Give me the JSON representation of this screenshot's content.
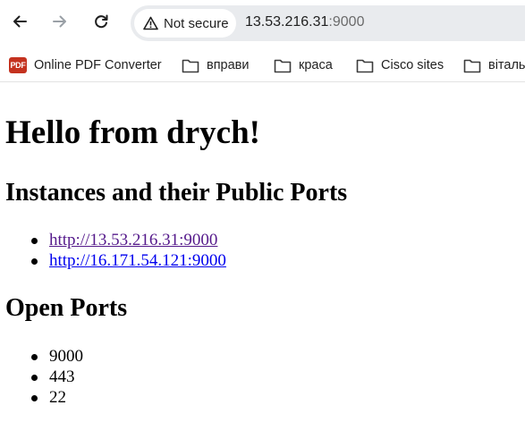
{
  "browser": {
    "security_label": "Not secure",
    "url_host": "13.53.216.31",
    "url_port": ":9000"
  },
  "bookmarks": [
    {
      "label": "Online PDF Converter",
      "icon": "pdf-icon",
      "badge": "PDF"
    },
    {
      "label": "вправи",
      "icon": "folder-icon"
    },
    {
      "label": "краса",
      "icon": "folder-icon"
    },
    {
      "label": "Cisco sites",
      "icon": "folder-icon"
    },
    {
      "label": "віталь",
      "icon": "folder-icon"
    }
  ],
  "page": {
    "heading": "Hello from drych!",
    "instances_heading": "Instances and their Public Ports",
    "instances": [
      {
        "url": "http://13.53.216.31:9000",
        "visited": true
      },
      {
        "url": "http://16.171.54.121:9000",
        "visited": false
      }
    ],
    "ports_heading": "Open Ports",
    "ports": [
      "9000",
      "443",
      "22"
    ]
  },
  "colors": {
    "link_visited": "#551a8b",
    "link_unvisited": "#0000ee",
    "omnibox_bg": "#e9ebee",
    "pdf_badge": "#c4321f"
  }
}
